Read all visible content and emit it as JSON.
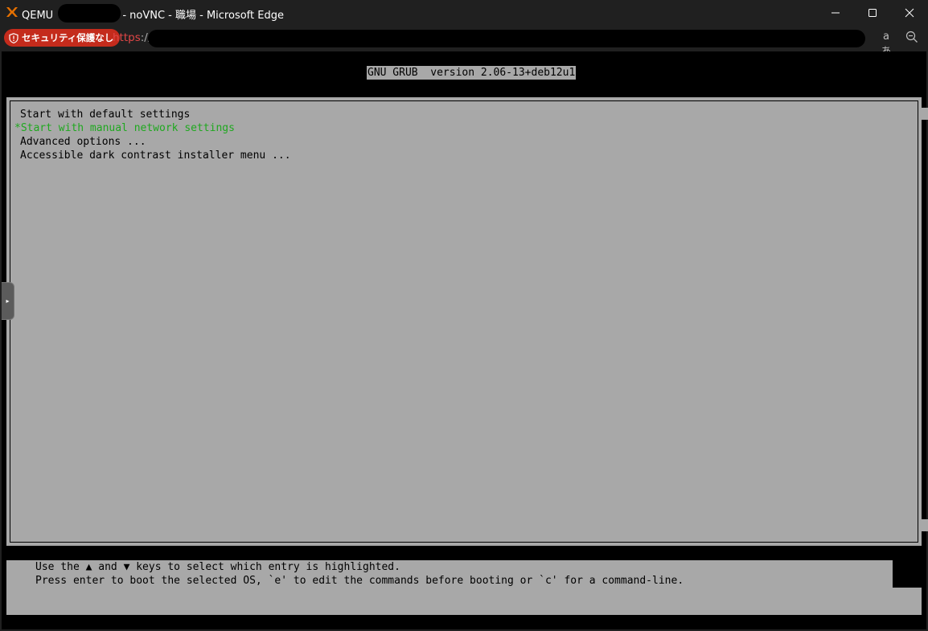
{
  "window": {
    "title_prefix": "QEMU",
    "title_suffix": "- noVNC - 職場 - Microsoft Edge",
    "controls": {
      "minimize": "minimize",
      "maximize": "maximize",
      "close": "close"
    }
  },
  "address_bar": {
    "security_label": "セキュリティ保護なし",
    "url_scheme": "https",
    "url_sep": "://",
    "read_aloud_glyph": "aあ",
    "zoom_icon": "zoom-out-icon"
  },
  "grub": {
    "header": "GNU GRUB  version 2.06-13+deb12u1",
    "menu": [
      {
        "label": "Start with default settings",
        "selected": false
      },
      {
        "label": "*Start with manual network settings",
        "selected": true
      },
      {
        "label": "Advanced options ...",
        "selected": false
      },
      {
        "label": "Accessible dark contrast installer menu ...",
        "selected": false
      }
    ],
    "help": [
      "Use the ▲ and ▼ keys to select which entry is highlighted.",
      "Press enter to boot the selected OS, `e' to edit the commands before booting or `c' for a command-line."
    ],
    "colors": {
      "background": "#a8a8a8",
      "selected": "#1fa81f",
      "text": "#000000"
    }
  },
  "novnc": {
    "sidebar_handle_glyph": "▸"
  }
}
